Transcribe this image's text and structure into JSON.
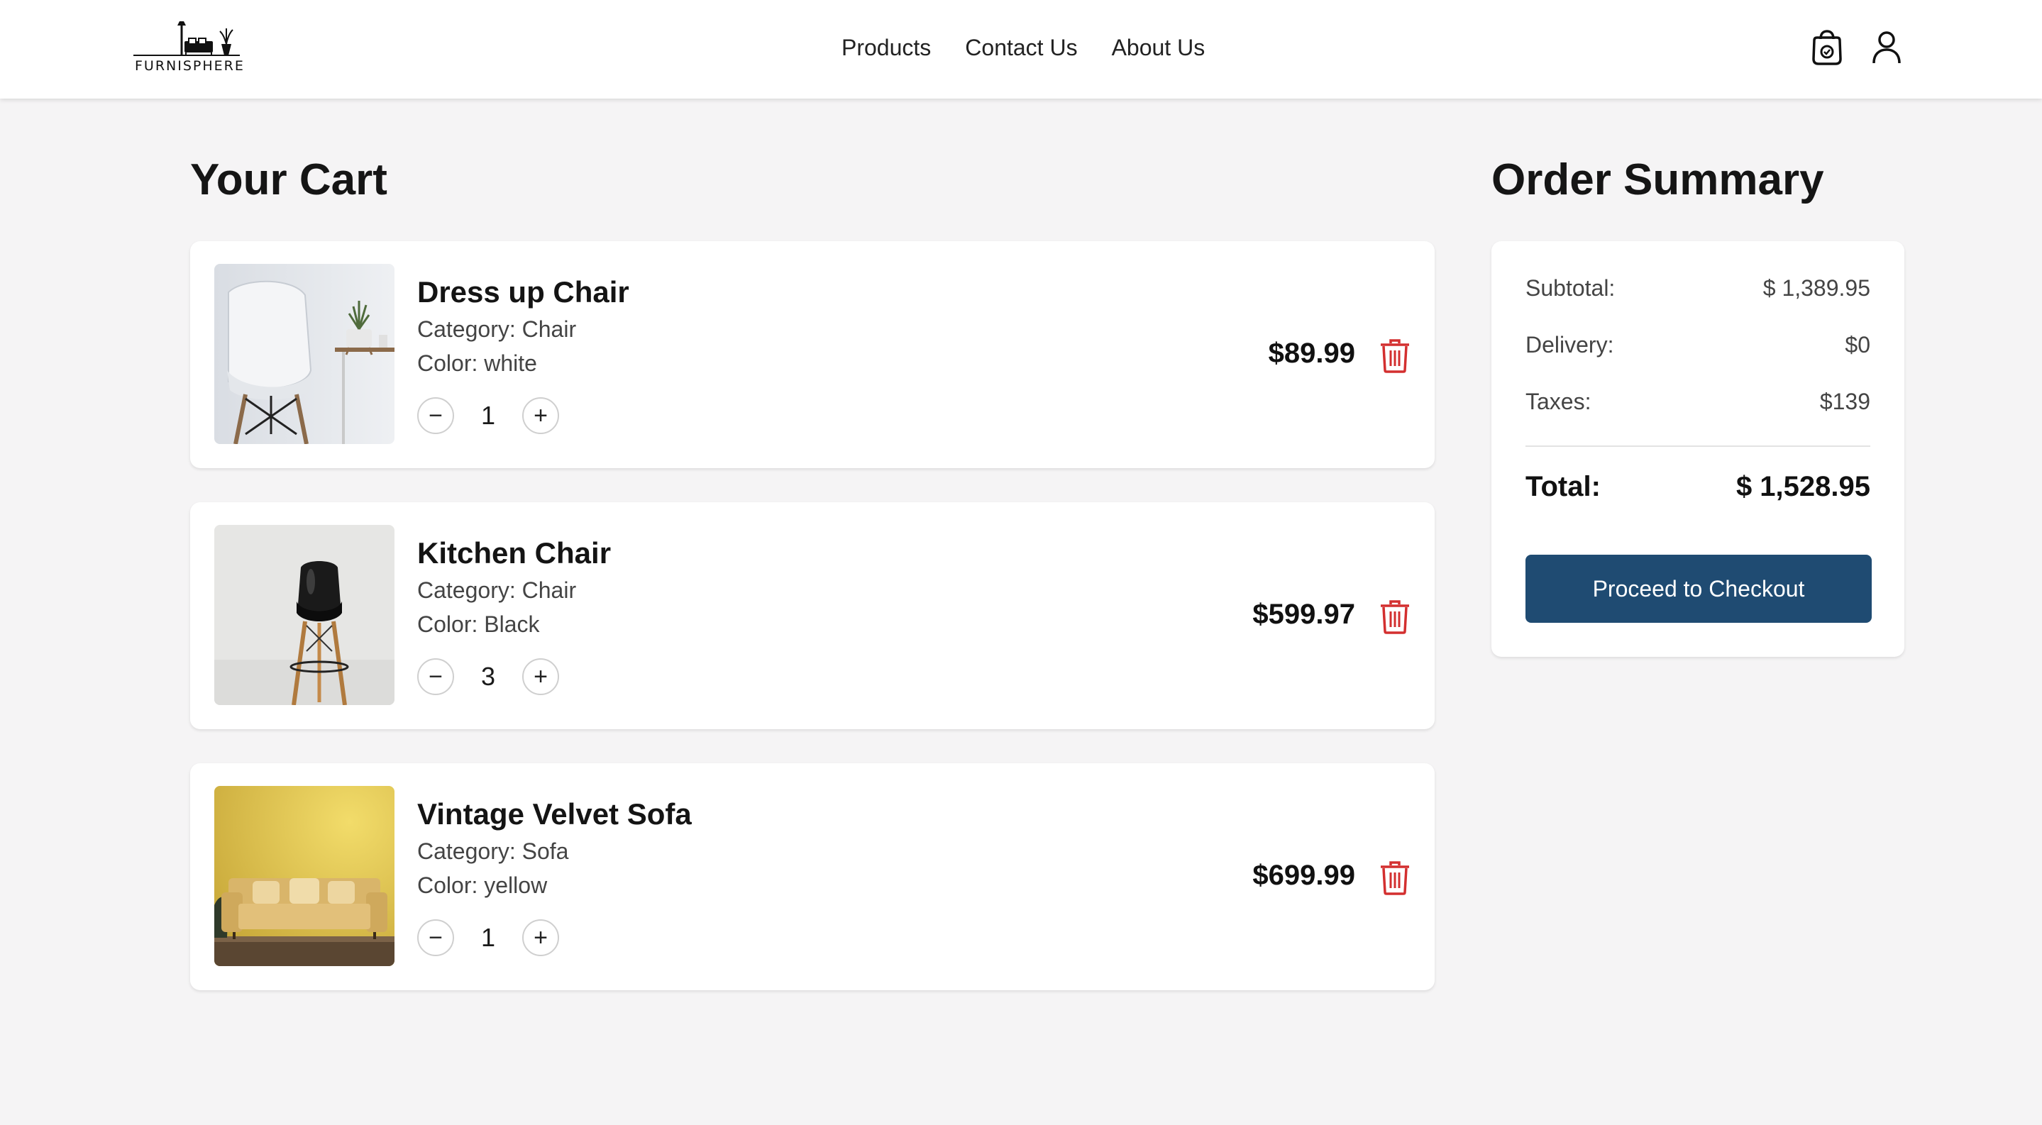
{
  "brand": {
    "name": "FURNISPHERE"
  },
  "nav": {
    "items": [
      {
        "label": "Products"
      },
      {
        "label": "Contact Us"
      },
      {
        "label": "About Us"
      }
    ]
  },
  "header_icons": [
    "shopping-bag-icon",
    "user-icon"
  ],
  "cart": {
    "title": "Your Cart",
    "items": [
      {
        "name": "Dress up Chair",
        "category": "Category: Chair",
        "color": "Color: white",
        "quantity": "1",
        "price": "$89.99",
        "image": "white-chair-image"
      },
      {
        "name": "Kitchen Chair",
        "category": "Category: Chair",
        "color": "Color: Black",
        "quantity": "3",
        "price": "$599.97",
        "image": "black-bar-chair-image"
      },
      {
        "name": "Vintage Velvet Sofa",
        "category": "Category: Sofa",
        "color": "Color: yellow",
        "quantity": "1",
        "price": "$699.99",
        "image": "yellow-sofa-image"
      }
    ],
    "decrease_glyph": "−",
    "increase_glyph": "+"
  },
  "summary": {
    "title": "Order Summary",
    "subtotal_label": "Subtotal:",
    "subtotal_value": "$ 1,389.95",
    "delivery_label": "Delivery:",
    "delivery_value": "$0",
    "taxes_label": "Taxes:",
    "taxes_value": "$139",
    "total_label": "Total:",
    "total_value": "$ 1,528.95",
    "checkout_label": "Proceed to Checkout"
  },
  "colors": {
    "accent": "#1f4b72",
    "delete": "#d32f2f",
    "background": "#f5f4f5"
  }
}
